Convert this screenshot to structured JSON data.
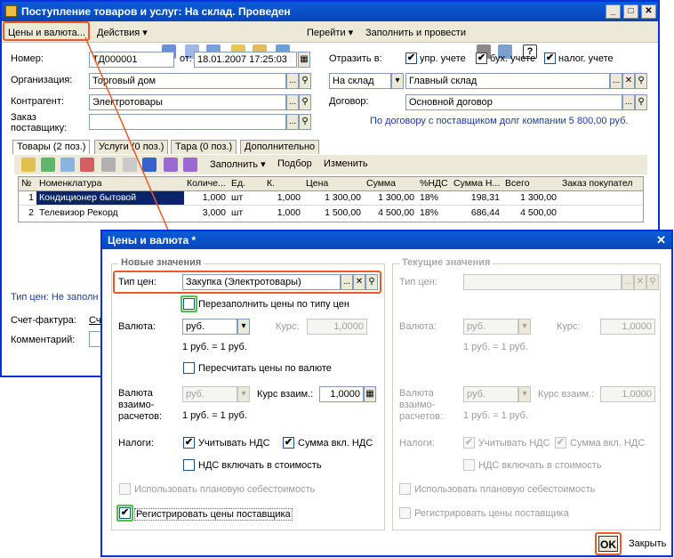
{
  "doc": {
    "title": "Поступление товаров и услуг: На склад. Проведен",
    "toolbar": {
      "prices_btn": "Цены и валюта...",
      "actions": "Действия",
      "goto": "Перейти",
      "fill_post": "Заполнить и провести"
    },
    "number_label": "Номер:",
    "number_value": "ТД000001",
    "from_label": "от:",
    "date_value": "18.01.2007 17:25:03",
    "reflect_label": "Отразить в:",
    "cb_upr": "упр. учете",
    "cb_buh": "бух. учете",
    "cb_nal": "налог. учете",
    "org_label": "Организация:",
    "org_value": "Торговый дом",
    "warehouse_type": "На склад",
    "warehouse_value": "Главный склад",
    "counterparty_label": "Контрагент:",
    "counterparty_value": "Электротовары",
    "contract_label": "Договор:",
    "contract_value": "Основной договор",
    "order_label": "Заказ поставщику:",
    "debt_text": "По договору с поставщиком долг компании 5 800,00 руб.",
    "tabs": [
      "Товары (2 поз.)",
      "Услуги (0 поз.)",
      "Тара (0 поз.)",
      "Дополнительно"
    ],
    "table_toolbar": {
      "fill": "Заполнить",
      "selection": "Подбор",
      "change": "Изменить"
    },
    "columns": [
      "№",
      "Номенклатура",
      "Количе...",
      "Ед.",
      "К.",
      "Цена",
      "Сумма",
      "%НДС",
      "Сумма Н...",
      "Всего",
      "Заказ покупател"
    ],
    "rows": [
      [
        "1",
        "Кондиционер бытовой",
        "1,000",
        "шт",
        "1,000",
        "1 300,00",
        "1 300,00",
        "18%",
        "198,31",
        "1 300,00",
        ""
      ],
      [
        "2",
        "Телевизор Рекорд",
        "3,000",
        "шт",
        "1,000",
        "1 500,00",
        "4 500,00",
        "18%",
        "686,44",
        "4 500,00",
        ""
      ]
    ],
    "price_type_partial": "Тип цен: Не заполн",
    "invoice_label": "Счет-фактура:",
    "invoice_partial": "Сч",
    "comment_label": "Комментарий:"
  },
  "dialog": {
    "title": "Цены и валюта *",
    "new_group": "Новые значения",
    "cur_group": "Текущие значения",
    "price_type_label": "Тип цен:",
    "price_type_value": "Закупка (Электротовары)",
    "refill_label": "Перезаполнить цены по типу цен",
    "currency_label": "Валюта:",
    "currency_value": "руб.",
    "rate_label": "Курс:",
    "rate_value": "1,0000",
    "rate_text": "1 руб. = 1 руб.",
    "recalc_label": "Пересчитать цены по валюте",
    "settle_currency_label": "Валюта взаимо-расчетов:",
    "settle_currency_value": "руб.",
    "settle_rate_label": "Курс взаим.:",
    "settle_rate_value": "1,0000",
    "taxes_label": "Налоги:",
    "vat_label": "Учитывать НДС",
    "sum_vat_label": "Сумма вкл. НДС",
    "vat_in_cost_label": "НДС включать в стоимость",
    "planned_cost_label": "Использовать плановую себестоимость",
    "register_prices_label": "Регистрировать цены поставщика",
    "ok": "OK",
    "close": "Закрыть"
  },
  "colors": {
    "titlebar": "#0a5bd8",
    "highlight": "#ee5a26",
    "checkbox_focus": "#4cc44c",
    "selected_row": "#0a246a"
  }
}
